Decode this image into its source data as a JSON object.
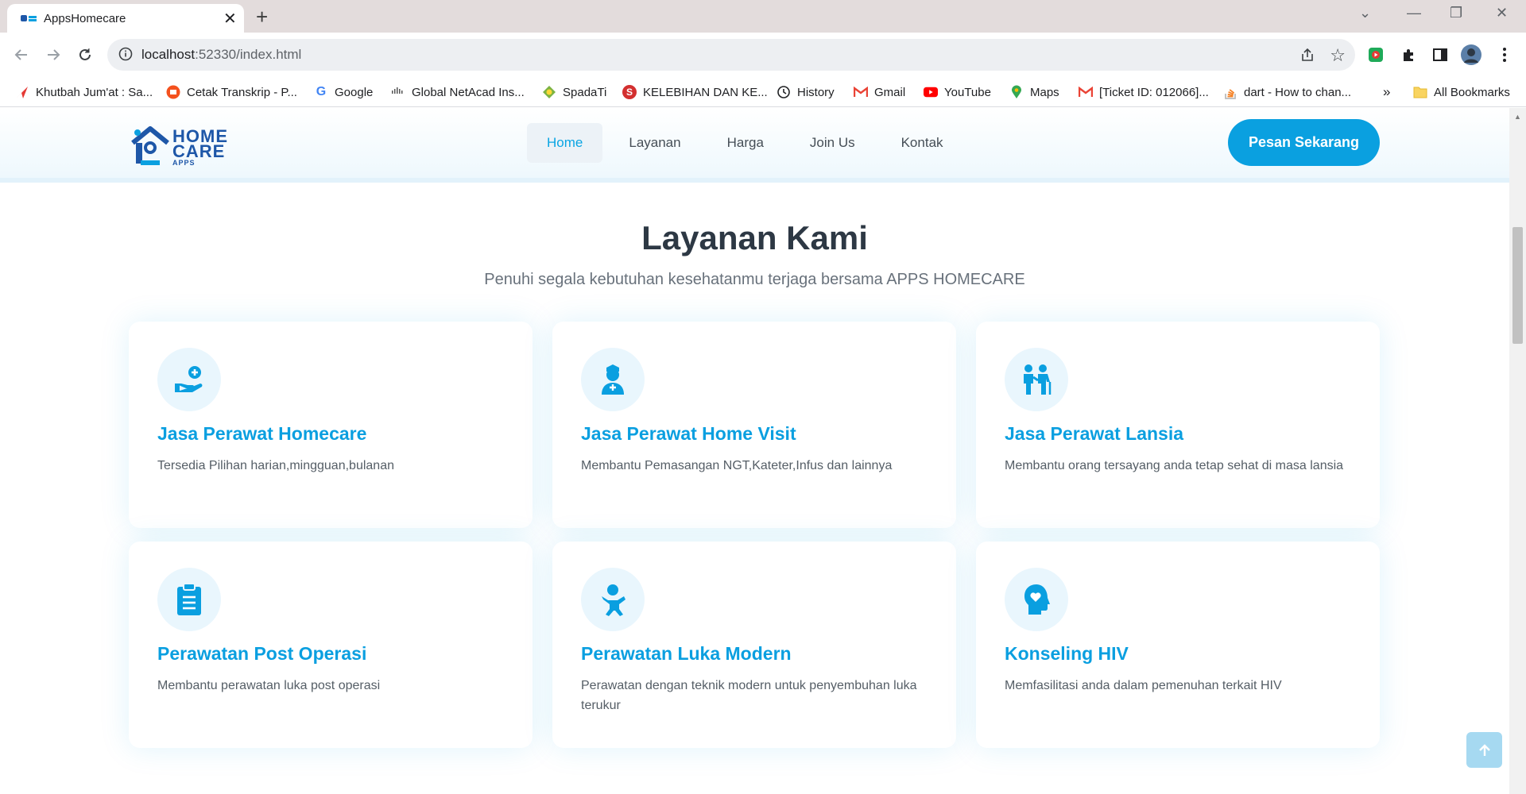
{
  "browser": {
    "tab_title": "AppsHomecare",
    "url_host": "localhost",
    "url_rest": ":52330/index.html",
    "bookmarks": [
      {
        "label": "Khutbah Jum'at : Sa...",
        "icon": "red-arrow-icon"
      },
      {
        "label": "Cetak Transkrip - P...",
        "icon": "orange-app-icon"
      },
      {
        "label": "Google",
        "icon": "google-icon"
      },
      {
        "label": "Global NetAcad Ins...",
        "icon": "cisco-icon"
      },
      {
        "label": "SpadaTi",
        "icon": "spada-icon"
      },
      {
        "label": "KELEBIHAN DAN KE...",
        "icon": "s-red-icon"
      },
      {
        "label": "History",
        "icon": "history-icon"
      },
      {
        "label": "Gmail",
        "icon": "gmail-icon"
      },
      {
        "label": "YouTube",
        "icon": "youtube-icon"
      },
      {
        "label": "Maps",
        "icon": "maps-icon"
      },
      {
        "label": "[Ticket ID: 012066]...",
        "icon": "gmail-icon"
      },
      {
        "label": "dart - How to chan...",
        "icon": "stackoverflow-icon"
      }
    ],
    "more_bookmarks": "»",
    "all_bookmarks": "All Bookmarks"
  },
  "site": {
    "logo": {
      "line1": "HOME",
      "line2": "CARE",
      "line3": "APPS"
    },
    "nav": [
      "Home",
      "Layanan",
      "Harga",
      "Join Us",
      "Kontak"
    ],
    "active_nav": "Home",
    "cta": "Pesan Sekarang"
  },
  "services": {
    "title": "Layanan Kami",
    "subtitle": "Penuhi segala kebutuhan kesehatanmu terjaga bersama APPS HOMECARE",
    "cards": [
      {
        "title": "Jasa Perawat Homecare",
        "desc": "Tersedia Pilihan harian,mingguan,bulanan",
        "icon": "hand-medical-icon"
      },
      {
        "title": "Jasa Perawat Home Visit",
        "desc": "Membantu Pemasangan NGT,Kateter,Infus dan lainnya",
        "icon": "user-nurse-icon"
      },
      {
        "title": "Jasa Perawat Lansia",
        "desc": "Membantu orang tersayang anda tetap sehat di masa lansia",
        "icon": "elderly-care-icon"
      },
      {
        "title": "Perawatan Post Operasi",
        "desc": "Membantu perawatan luka post operasi",
        "icon": "clipboard-icon"
      },
      {
        "title": "Perawatan Luka Modern",
        "desc": "Perawatan dengan teknik modern untuk penyembuhan luka terukur",
        "icon": "baby-icon"
      },
      {
        "title": "Konseling HIV",
        "desc": "Memfasilitasi anda dalam pemenuhan terkait HIV",
        "icon": "head-heart-icon"
      }
    ]
  },
  "colors": {
    "accent": "#0aa0e0",
    "heading": "#2d3844",
    "logo": "#1e57a8"
  }
}
